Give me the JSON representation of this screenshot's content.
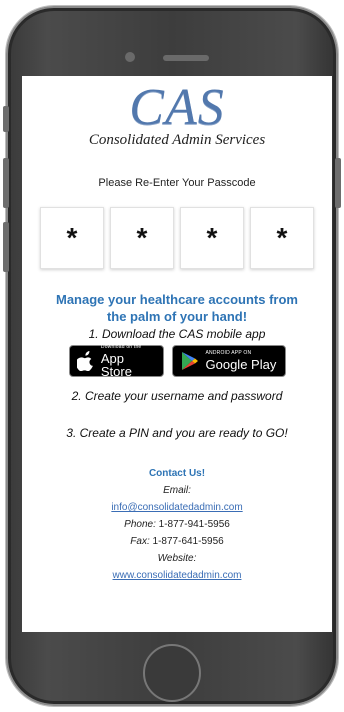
{
  "logo": {
    "mark": "CAS",
    "company": "Consolidated Admin Services"
  },
  "passcode": {
    "prompt": "Please Re-Enter Your Passcode",
    "digits": [
      "*",
      "*",
      "*",
      "*"
    ]
  },
  "promo": {
    "headline_line1": "Manage your healthcare accounts from",
    "headline_line2": "the palm of your hand!",
    "step1": "1. Download the CAS mobile app",
    "step2": "2. Create your username and password",
    "step3": "3. Create a PIN and you are ready to GO!"
  },
  "stores": {
    "apple_small": "Download on the",
    "apple_big": "App Store",
    "google_small": "ANDROID APP ON",
    "google_big": "Google Play"
  },
  "contact": {
    "title": "Contact Us!",
    "email_label": "Email:",
    "email": "info@consolidatedadmin.com",
    "phone_label": "Phone:",
    "phone": "1-877-941-5956",
    "fax_label": "Fax:",
    "fax": "1-877-641-5956",
    "website_label": "Website:",
    "website": "www.consolidatedadmin.com"
  },
  "colors": {
    "accent": "#2e74b5",
    "logo": "#5278ad",
    "phone_frame": "#3d3d3d"
  }
}
